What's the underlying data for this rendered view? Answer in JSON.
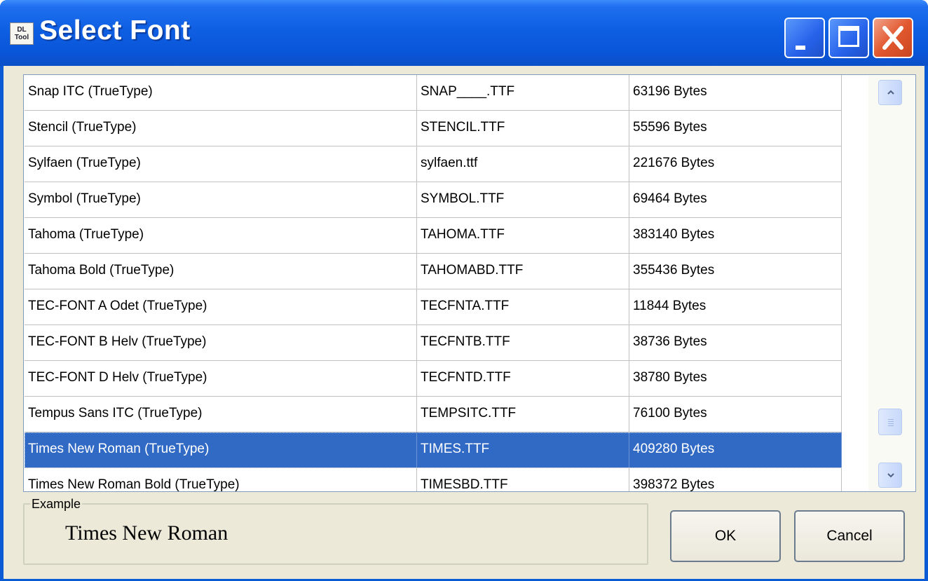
{
  "window": {
    "title": "Select Font",
    "icon_label": "DL Tool",
    "title_bar_color": "#0a5ad6",
    "selection_color": "#316ac5"
  },
  "caption_buttons": {
    "minimize": "minimize-icon",
    "maximize": "maximize-icon",
    "close": "close-icon"
  },
  "font_list": {
    "rows": [
      {
        "name": "Snap ITC (TrueType)",
        "file": "SNAP____.TTF",
        "size": "63196 Bytes"
      },
      {
        "name": "Stencil (TrueType)",
        "file": "STENCIL.TTF",
        "size": "55596 Bytes"
      },
      {
        "name": "Sylfaen (TrueType)",
        "file": "sylfaen.ttf",
        "size": "221676 Bytes"
      },
      {
        "name": "Symbol (TrueType)",
        "file": "SYMBOL.TTF",
        "size": "69464 Bytes"
      },
      {
        "name": "Tahoma (TrueType)",
        "file": "TAHOMA.TTF",
        "size": "383140 Bytes"
      },
      {
        "name": "Tahoma Bold (TrueType)",
        "file": "TAHOMABD.TTF",
        "size": "355436 Bytes"
      },
      {
        "name": "TEC-FONT A Odet (TrueType)",
        "file": "TECFNTA.TTF",
        "size": "11844 Bytes"
      },
      {
        "name": "TEC-FONT B Helv (TrueType)",
        "file": "TECFNTB.TTF",
        "size": "38736 Bytes"
      },
      {
        "name": "TEC-FONT D Helv (TrueType)",
        "file": "TECFNTD.TTF",
        "size": "38780 Bytes"
      },
      {
        "name": "Tempus Sans ITC (TrueType)",
        "file": "TEMPSITC.TTF",
        "size": "76100 Bytes"
      },
      {
        "name": "Times New Roman (TrueType)",
        "file": "TIMES.TTF",
        "size": "409280 Bytes"
      },
      {
        "name": "Times New Roman Bold (TrueType)",
        "file": "TIMESBD.TTF",
        "size": "398372 Bytes"
      }
    ],
    "selected_index": 10
  },
  "example": {
    "label": "Example",
    "preview_text": "Times New Roman"
  },
  "buttons": {
    "ok": "OK",
    "cancel": "Cancel"
  }
}
